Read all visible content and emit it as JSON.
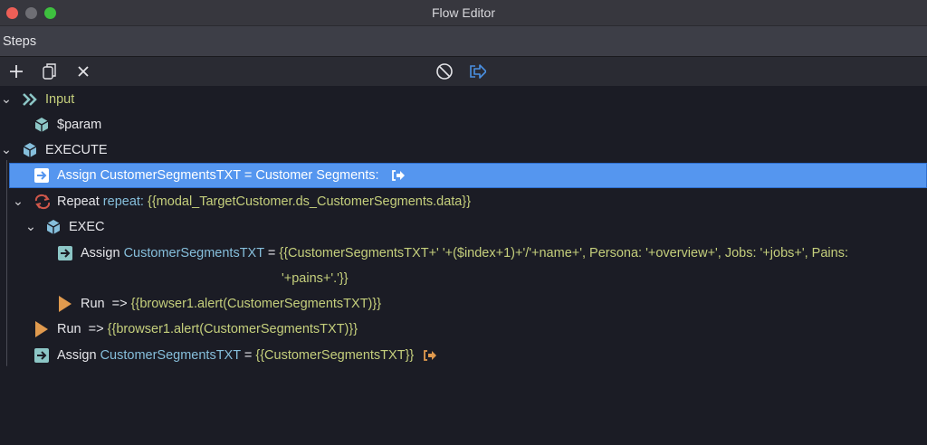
{
  "window": {
    "title": "Flow Editor"
  },
  "panel": {
    "title": "Steps"
  },
  "toolbar": {
    "add": "add",
    "copy": "copy",
    "delete": "delete",
    "disable": "disable",
    "exit": "exit"
  },
  "tree": {
    "input": {
      "label": "Input"
    },
    "param": {
      "label": "$param"
    },
    "execute": {
      "label": "EXECUTE"
    },
    "assign1": {
      "keyword": "Assign",
      "text": "CustomerSegmentsTXT = Customer Segments:"
    },
    "repeat": {
      "keyword": "Repeat",
      "attr": "repeat:",
      "value": "{{modal_TargetCustomer.ds_CustomerSegments.data}}"
    },
    "exec": {
      "label": "EXEC"
    },
    "assign2": {
      "keyword": "Assign",
      "var": "CustomerSegmentsTXT",
      "eq": "=",
      "value1": "{{CustomerSegmentsTXT+' '+($index+1)+'/'+name+', Persona: '+overview+', Jobs: '+jobs+', Pains:",
      "value2": "'+pains+'.'}}"
    },
    "run1": {
      "keyword": "Run",
      "arrow": "=>",
      "value": "{{browser1.alert(CustomerSegmentsTXT)}}"
    },
    "run2": {
      "keyword": "Run",
      "arrow": "=>",
      "value": "{{browser1.alert(CustomerSegmentsTXT)}}"
    },
    "assign3": {
      "keyword": "Assign",
      "var": "CustomerSegmentsTXT",
      "eq": "=",
      "value": "{{CustomerSegmentsTXT}}"
    }
  },
  "colors": {
    "accent": "#5596ef",
    "yellow": "#c5cf7c",
    "blue": "#86bfdc",
    "orange": "#e09a4e",
    "teal": "#8cc6c6"
  }
}
